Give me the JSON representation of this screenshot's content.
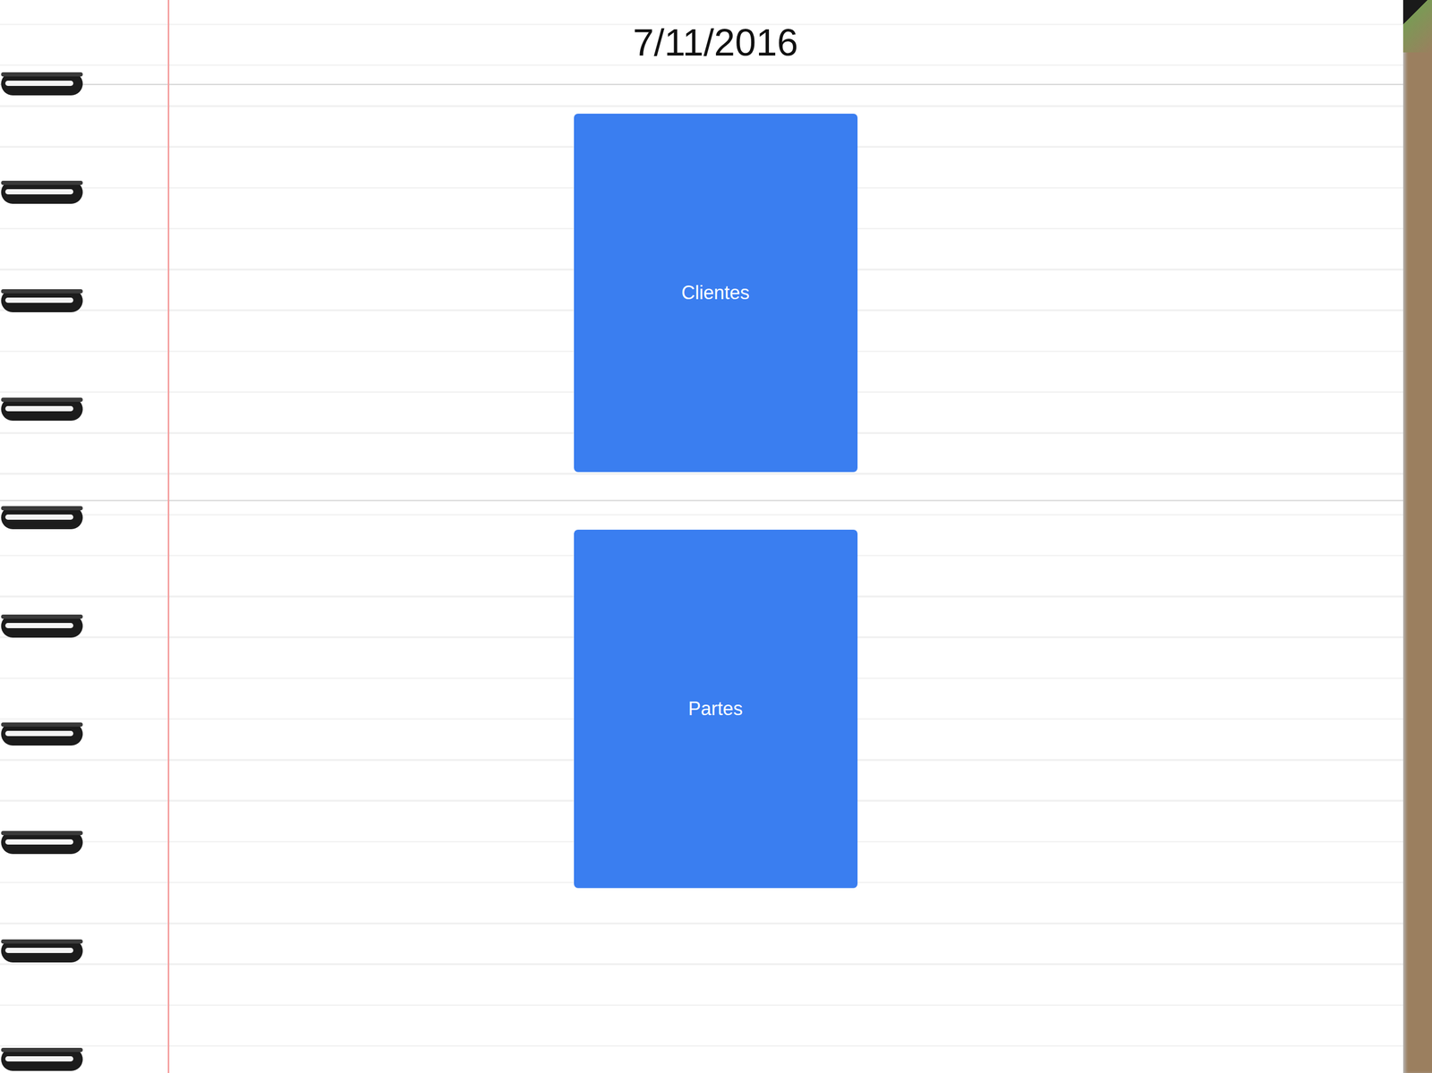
{
  "page": {
    "date": "7/11/2016"
  },
  "buttons": [
    {
      "label": "Clientes"
    },
    {
      "label": "Partes"
    }
  ]
}
